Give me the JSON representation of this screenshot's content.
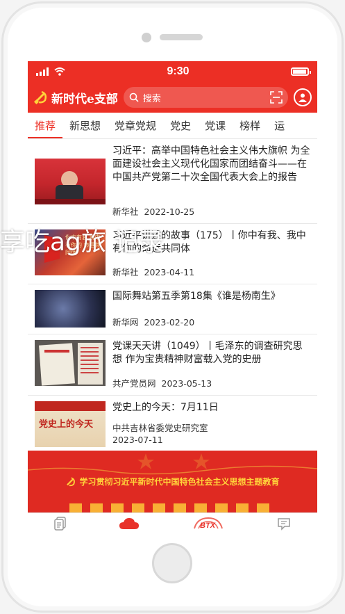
{
  "status_bar": {
    "time": "9:30"
  },
  "app_bar": {
    "brand_title": "新时代e支部",
    "search_placeholder": "搜索"
  },
  "tabs": [
    {
      "label": "推荐",
      "active": true
    },
    {
      "label": "新思想",
      "active": false
    },
    {
      "label": "党章党规",
      "active": false
    },
    {
      "label": "党史",
      "active": false
    },
    {
      "label": "党课",
      "active": false
    },
    {
      "label": "榜样",
      "active": false
    },
    {
      "label": "运",
      "active": false
    }
  ],
  "feed": [
    {
      "headline": "习近平：高举中国特色社会主义伟大旗帜 为全面建设社会主义现代化国家而团结奋斗——在中国共产党第二十次全国代表大会上的报告",
      "source": "新华社",
      "date": "2022-10-25"
    },
    {
      "headline": "习近平讲述的故事（175）丨你中有我、我中有你的命运共同体",
      "source": "新华社",
      "date": "2023-04-11",
      "thumb_caption": "你中有我 我中有你的 命运共同体"
    },
    {
      "headline": "国际舞站第五季第18集《谁是杨南生》",
      "source": "新华网",
      "date": "2023-02-20"
    },
    {
      "headline": "党课天天讲（1049）丨毛泽东的调查研究思想 作为宝贵精神财富载入党的史册",
      "source": "共产党员网",
      "date": "2023-05-13"
    },
    {
      "headline": "党史上的今天：7月11日",
      "source": "中共吉林省委党史研究室",
      "date": "2023-07-11",
      "thumb_caption": "党史上的今天"
    }
  ],
  "overlay_text": "享吃ag旅        记录",
  "banner_text": "学习贯彻习近平新时代中国特色社会主义思想主题教育",
  "bottom_nav": {
    "center_logo": "BTX"
  },
  "colors": {
    "accent": "#ec2f25",
    "banner": "#df2a22"
  }
}
